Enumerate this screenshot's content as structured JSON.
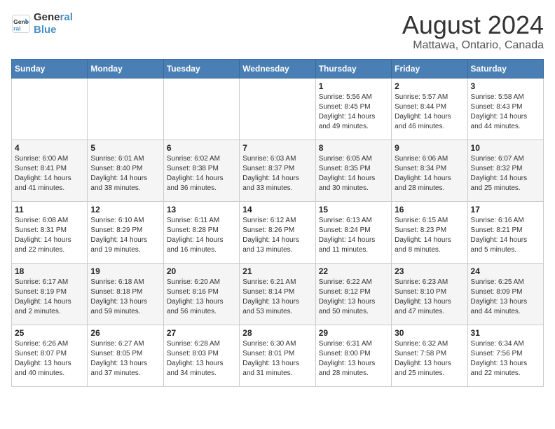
{
  "header": {
    "logo_line1": "General",
    "logo_line2": "Blue",
    "month_year": "August 2024",
    "location": "Mattawa, Ontario, Canada"
  },
  "days_of_week": [
    "Sunday",
    "Monday",
    "Tuesday",
    "Wednesday",
    "Thursday",
    "Friday",
    "Saturday"
  ],
  "weeks": [
    [
      {
        "day": "",
        "info": ""
      },
      {
        "day": "",
        "info": ""
      },
      {
        "day": "",
        "info": ""
      },
      {
        "day": "",
        "info": ""
      },
      {
        "day": "1",
        "info": "Sunrise: 5:56 AM\nSunset: 8:45 PM\nDaylight: 14 hours\nand 49 minutes."
      },
      {
        "day": "2",
        "info": "Sunrise: 5:57 AM\nSunset: 8:44 PM\nDaylight: 14 hours\nand 46 minutes."
      },
      {
        "day": "3",
        "info": "Sunrise: 5:58 AM\nSunset: 8:43 PM\nDaylight: 14 hours\nand 44 minutes."
      }
    ],
    [
      {
        "day": "4",
        "info": "Sunrise: 6:00 AM\nSunset: 8:41 PM\nDaylight: 14 hours\nand 41 minutes."
      },
      {
        "day": "5",
        "info": "Sunrise: 6:01 AM\nSunset: 8:40 PM\nDaylight: 14 hours\nand 38 minutes."
      },
      {
        "day": "6",
        "info": "Sunrise: 6:02 AM\nSunset: 8:38 PM\nDaylight: 14 hours\nand 36 minutes."
      },
      {
        "day": "7",
        "info": "Sunrise: 6:03 AM\nSunset: 8:37 PM\nDaylight: 14 hours\nand 33 minutes."
      },
      {
        "day": "8",
        "info": "Sunrise: 6:05 AM\nSunset: 8:35 PM\nDaylight: 14 hours\nand 30 minutes."
      },
      {
        "day": "9",
        "info": "Sunrise: 6:06 AM\nSunset: 8:34 PM\nDaylight: 14 hours\nand 28 minutes."
      },
      {
        "day": "10",
        "info": "Sunrise: 6:07 AM\nSunset: 8:32 PM\nDaylight: 14 hours\nand 25 minutes."
      }
    ],
    [
      {
        "day": "11",
        "info": "Sunrise: 6:08 AM\nSunset: 8:31 PM\nDaylight: 14 hours\nand 22 minutes."
      },
      {
        "day": "12",
        "info": "Sunrise: 6:10 AM\nSunset: 8:29 PM\nDaylight: 14 hours\nand 19 minutes."
      },
      {
        "day": "13",
        "info": "Sunrise: 6:11 AM\nSunset: 8:28 PM\nDaylight: 14 hours\nand 16 minutes."
      },
      {
        "day": "14",
        "info": "Sunrise: 6:12 AM\nSunset: 8:26 PM\nDaylight: 14 hours\nand 13 minutes."
      },
      {
        "day": "15",
        "info": "Sunrise: 6:13 AM\nSunset: 8:24 PM\nDaylight: 14 hours\nand 11 minutes."
      },
      {
        "day": "16",
        "info": "Sunrise: 6:15 AM\nSunset: 8:23 PM\nDaylight: 14 hours\nand 8 minutes."
      },
      {
        "day": "17",
        "info": "Sunrise: 6:16 AM\nSunset: 8:21 PM\nDaylight: 14 hours\nand 5 minutes."
      }
    ],
    [
      {
        "day": "18",
        "info": "Sunrise: 6:17 AM\nSunset: 8:19 PM\nDaylight: 14 hours\nand 2 minutes."
      },
      {
        "day": "19",
        "info": "Sunrise: 6:18 AM\nSunset: 8:18 PM\nDaylight: 13 hours\nand 59 minutes."
      },
      {
        "day": "20",
        "info": "Sunrise: 6:20 AM\nSunset: 8:16 PM\nDaylight: 13 hours\nand 56 minutes."
      },
      {
        "day": "21",
        "info": "Sunrise: 6:21 AM\nSunset: 8:14 PM\nDaylight: 13 hours\nand 53 minutes."
      },
      {
        "day": "22",
        "info": "Sunrise: 6:22 AM\nSunset: 8:12 PM\nDaylight: 13 hours\nand 50 minutes."
      },
      {
        "day": "23",
        "info": "Sunrise: 6:23 AM\nSunset: 8:10 PM\nDaylight: 13 hours\nand 47 minutes."
      },
      {
        "day": "24",
        "info": "Sunrise: 6:25 AM\nSunset: 8:09 PM\nDaylight: 13 hours\nand 44 minutes."
      }
    ],
    [
      {
        "day": "25",
        "info": "Sunrise: 6:26 AM\nSunset: 8:07 PM\nDaylight: 13 hours\nand 40 minutes."
      },
      {
        "day": "26",
        "info": "Sunrise: 6:27 AM\nSunset: 8:05 PM\nDaylight: 13 hours\nand 37 minutes."
      },
      {
        "day": "27",
        "info": "Sunrise: 6:28 AM\nSunset: 8:03 PM\nDaylight: 13 hours\nand 34 minutes."
      },
      {
        "day": "28",
        "info": "Sunrise: 6:30 AM\nSunset: 8:01 PM\nDaylight: 13 hours\nand 31 minutes."
      },
      {
        "day": "29",
        "info": "Sunrise: 6:31 AM\nSunset: 8:00 PM\nDaylight: 13 hours\nand 28 minutes."
      },
      {
        "day": "30",
        "info": "Sunrise: 6:32 AM\nSunset: 7:58 PM\nDaylight: 13 hours\nand 25 minutes."
      },
      {
        "day": "31",
        "info": "Sunrise: 6:34 AM\nSunset: 7:56 PM\nDaylight: 13 hours\nand 22 minutes."
      }
    ]
  ]
}
